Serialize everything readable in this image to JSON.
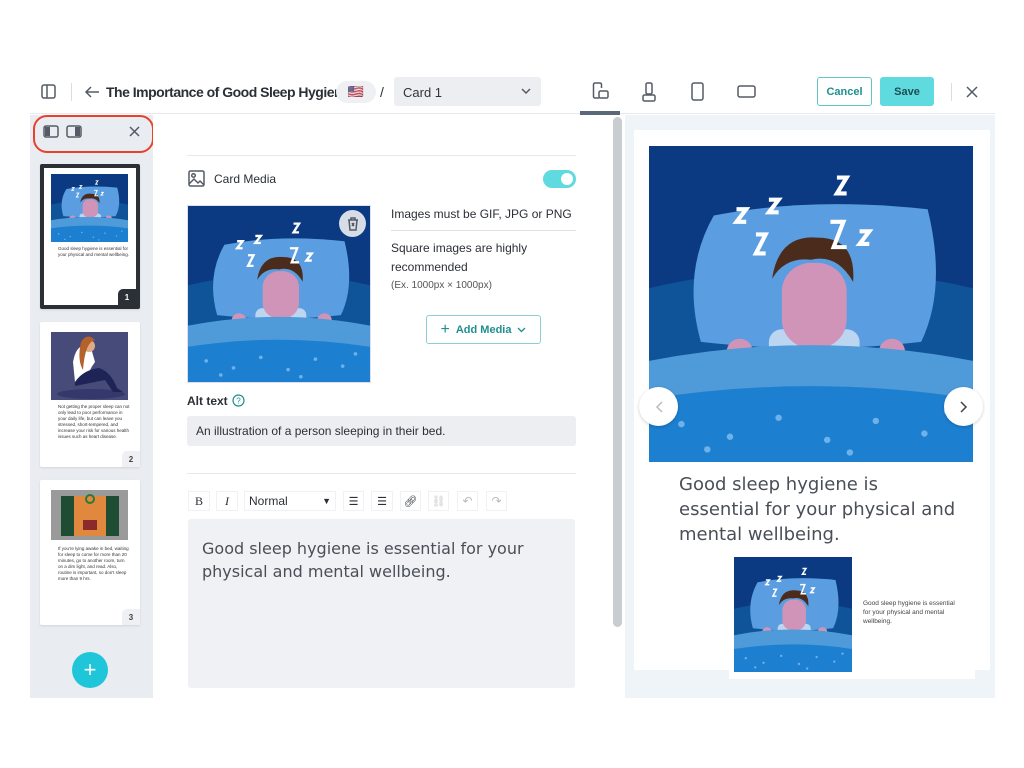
{
  "header": {
    "title": "The Importance of Good Sleep Hygiene",
    "language_flag": "🇺🇸",
    "separator": "/",
    "card_select": "Card 1",
    "cancel_label": "Cancel",
    "save_label": "Save",
    "view_modes": [
      "mobile-desktop",
      "mobile-portrait",
      "tablet-portrait",
      "landscape"
    ],
    "active_view": 0
  },
  "sidebar": {
    "cards": [
      {
        "number": "1",
        "text": "Good sleep hygiene is essential for your physical and mental wellbeing.",
        "selected": true
      },
      {
        "number": "2",
        "text": "Not getting the proper sleep can not only lead to poor performance in your daily life, but can leave you stressed, short-tempered, and increase your risk for various health issues such as heart disease.",
        "selected": false
      },
      {
        "number": "3",
        "text": "If you're lying awake in bed, waiting for sleep to come for more than 20 minutes, go to another room, turn on a dim light, and read. Also, routine is important, so don't sleep more than 9 hrs.",
        "selected": false
      }
    ],
    "add_button": "+"
  },
  "editor": {
    "card_media_label": "Card Media",
    "card_media_enabled": true,
    "image_rule": "Images must be GIF, JPG or PNG",
    "square_note": "Square images are highly recommended",
    "size_example": "(Ex. 1000px × 1000px)",
    "add_media_label": "Add Media",
    "alt_text_label": "Alt text",
    "alt_text_value": "An illustration of a person sleeping in their bed.",
    "toolbar": {
      "bold": "B",
      "italic": "I",
      "format": "Normal"
    },
    "body_text": "Good sleep hygiene is essential for your physical and mental wellbeing."
  },
  "preview": {
    "text": "Good sleep hygiene is essential for your physical and mental wellbeing.",
    "small_text": "Good sleep hygiene is essential for your physical and mental wellbeing."
  },
  "colors": {
    "accent": "#5fdbe0",
    "teal_text": "#1f8f8f",
    "highlight": "#e8412c"
  }
}
